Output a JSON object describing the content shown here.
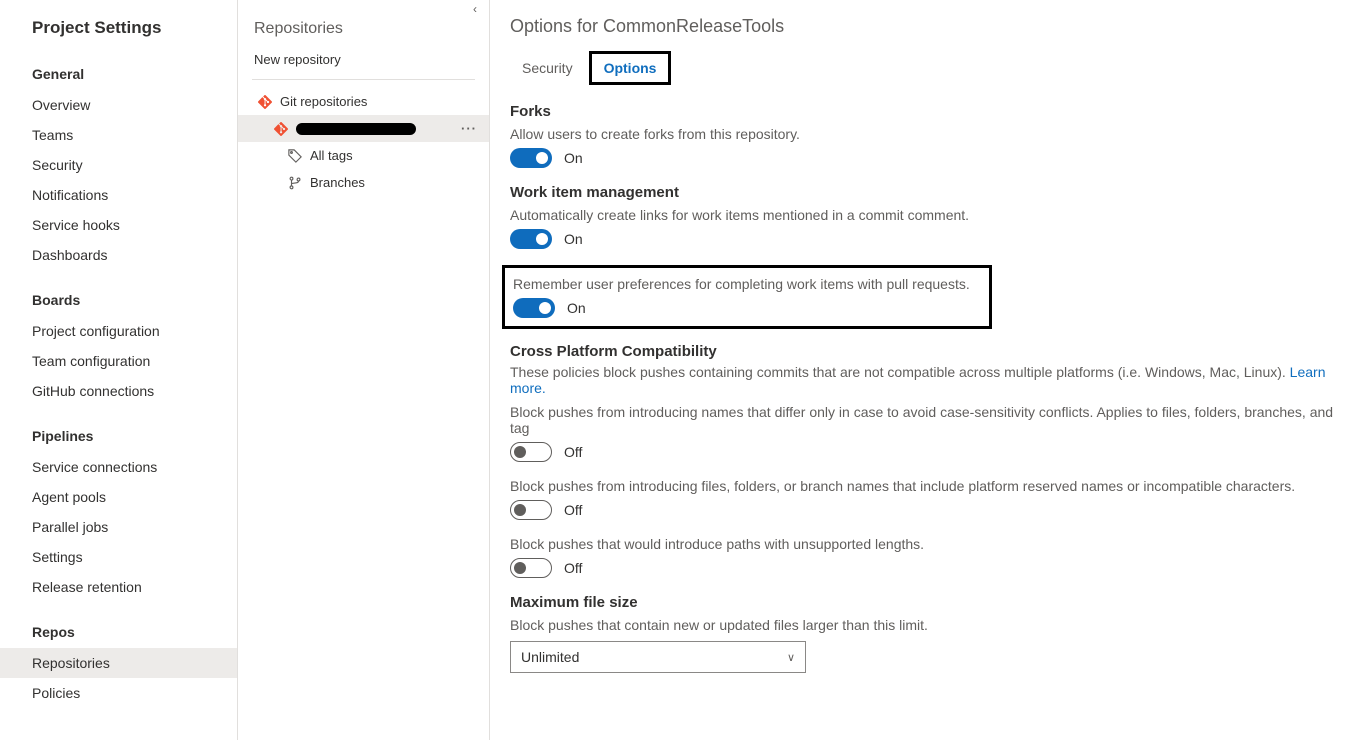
{
  "sidebar": {
    "title": "Project Settings",
    "groups": [
      {
        "heading": "General",
        "items": [
          "Overview",
          "Teams",
          "Security",
          "Notifications",
          "Service hooks",
          "Dashboards"
        ]
      },
      {
        "heading": "Boards",
        "items": [
          "Project configuration",
          "Team configuration",
          "GitHub connections"
        ]
      },
      {
        "heading": "Pipelines",
        "items": [
          "Service connections",
          "Agent pools",
          "Parallel jobs",
          "Settings",
          "Release retention"
        ]
      },
      {
        "heading": "Repos",
        "items": [
          "Repositories",
          "Policies"
        ]
      }
    ],
    "selected": "Repositories"
  },
  "repoPanel": {
    "title": "Repositories",
    "newRepo": "New repository",
    "rootLabel": "Git repositories",
    "allTags": "All tags",
    "branches": "Branches"
  },
  "main": {
    "title": "Options for CommonReleaseTools",
    "tabs": {
      "security": "Security",
      "options": "Options",
      "active": "options"
    },
    "forks": {
      "heading": "Forks",
      "desc": "Allow users to create forks from this repository.",
      "state": "On"
    },
    "workItem": {
      "heading": "Work item management",
      "autoLinkDesc": "Automatically create links for work items mentioned in a commit comment.",
      "autoLinkState": "On",
      "rememberDesc": "Remember user preferences for completing work items with pull requests.",
      "rememberState": "On"
    },
    "crossPlatform": {
      "heading": "Cross Platform Compatibility",
      "desc": "These policies block pushes containing commits that are not compatible across multiple platforms (i.e. Windows, Mac, Linux). ",
      "learnMore": "Learn more.",
      "caseDesc": "Block pushes from introducing names that differ only in case to avoid case-sensitivity conflicts. Applies to files, folders, branches, and tag",
      "caseState": "Off",
      "reservedDesc": "Block pushes from introducing files, folders, or branch names that include platform reserved names or incompatible characters.",
      "reservedState": "Off",
      "pathLenDesc": "Block pushes that would introduce paths with unsupported lengths.",
      "pathLenState": "Off"
    },
    "maxSize": {
      "heading": "Maximum file size",
      "desc": "Block pushes that contain new or updated files larger than this limit.",
      "value": "Unlimited"
    }
  }
}
